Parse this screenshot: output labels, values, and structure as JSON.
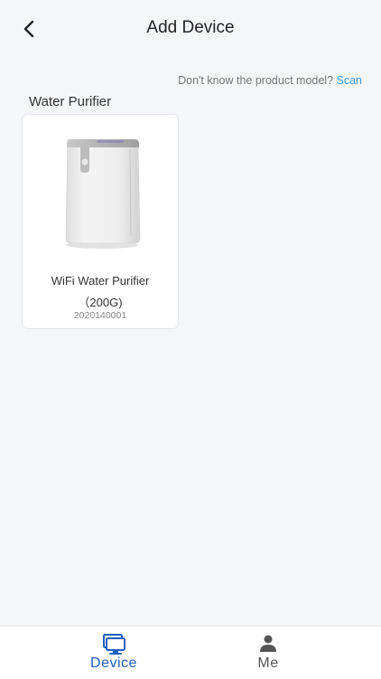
{
  "header": {
    "title": "Add Device"
  },
  "hint": {
    "text": "Don't know the product model? ",
    "link": "Scan"
  },
  "category": {
    "label": "Water Purifier"
  },
  "products": [
    {
      "name": "WiFi Water Purifier（200G)",
      "model": "2020140001"
    }
  ],
  "tabbar": {
    "tabs": [
      {
        "label": "Device",
        "icon": "monitor-icon",
        "active": true
      },
      {
        "label": "Me",
        "icon": "person-icon",
        "active": false
      }
    ]
  },
  "colors": {
    "accent": "#1f5fbf",
    "link": "#3a9be8",
    "background": "#f5f6f8"
  }
}
